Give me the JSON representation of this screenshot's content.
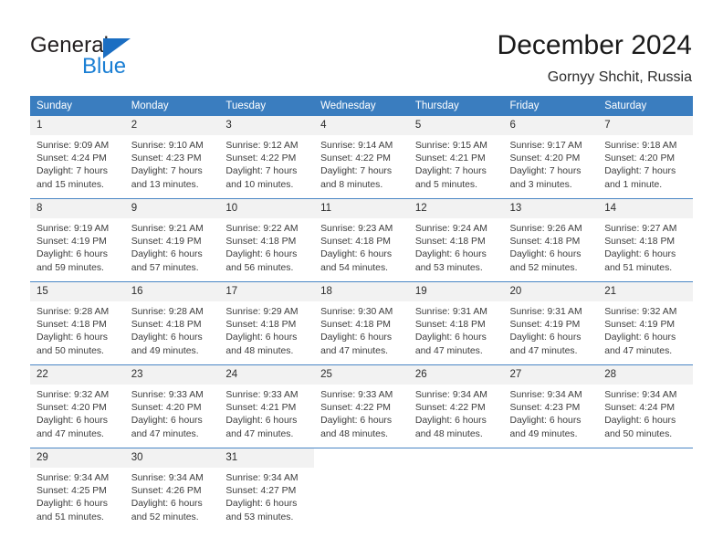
{
  "brand": {
    "name_primary": "General",
    "name_secondary": "Blue",
    "triangle_color": "#1b6ec2",
    "blue_text_color": "#1b7fd4"
  },
  "header": {
    "title": "December 2024",
    "subtitle": "Gornyy Shchit, Russia"
  },
  "theme": {
    "header_bar_color": "#3a7dbf",
    "row_divider_color": "#4a86c5",
    "daynum_band_color": "#f2f2f2",
    "body_text_color": "#3c3c3c"
  },
  "calendar": {
    "weekday_headers": [
      "Sunday",
      "Monday",
      "Tuesday",
      "Wednesday",
      "Thursday",
      "Friday",
      "Saturday"
    ],
    "weeks": [
      [
        {
          "day": "1",
          "lines": [
            "Sunrise: 9:09 AM",
            "Sunset: 4:24 PM",
            "Daylight: 7 hours",
            "and 15 minutes."
          ]
        },
        {
          "day": "2",
          "lines": [
            "Sunrise: 9:10 AM",
            "Sunset: 4:23 PM",
            "Daylight: 7 hours",
            "and 13 minutes."
          ]
        },
        {
          "day": "3",
          "lines": [
            "Sunrise: 9:12 AM",
            "Sunset: 4:22 PM",
            "Daylight: 7 hours",
            "and 10 minutes."
          ]
        },
        {
          "day": "4",
          "lines": [
            "Sunrise: 9:14 AM",
            "Sunset: 4:22 PM",
            "Daylight: 7 hours",
            "and 8 minutes."
          ]
        },
        {
          "day": "5",
          "lines": [
            "Sunrise: 9:15 AM",
            "Sunset: 4:21 PM",
            "Daylight: 7 hours",
            "and 5 minutes."
          ]
        },
        {
          "day": "6",
          "lines": [
            "Sunrise: 9:17 AM",
            "Sunset: 4:20 PM",
            "Daylight: 7 hours",
            "and 3 minutes."
          ]
        },
        {
          "day": "7",
          "lines": [
            "Sunrise: 9:18 AM",
            "Sunset: 4:20 PM",
            "Daylight: 7 hours",
            "and 1 minute."
          ]
        }
      ],
      [
        {
          "day": "8",
          "lines": [
            "Sunrise: 9:19 AM",
            "Sunset: 4:19 PM",
            "Daylight: 6 hours",
            "and 59 minutes."
          ]
        },
        {
          "day": "9",
          "lines": [
            "Sunrise: 9:21 AM",
            "Sunset: 4:19 PM",
            "Daylight: 6 hours",
            "and 57 minutes."
          ]
        },
        {
          "day": "10",
          "lines": [
            "Sunrise: 9:22 AM",
            "Sunset: 4:18 PM",
            "Daylight: 6 hours",
            "and 56 minutes."
          ]
        },
        {
          "day": "11",
          "lines": [
            "Sunrise: 9:23 AM",
            "Sunset: 4:18 PM",
            "Daylight: 6 hours",
            "and 54 minutes."
          ]
        },
        {
          "day": "12",
          "lines": [
            "Sunrise: 9:24 AM",
            "Sunset: 4:18 PM",
            "Daylight: 6 hours",
            "and 53 minutes."
          ]
        },
        {
          "day": "13",
          "lines": [
            "Sunrise: 9:26 AM",
            "Sunset: 4:18 PM",
            "Daylight: 6 hours",
            "and 52 minutes."
          ]
        },
        {
          "day": "14",
          "lines": [
            "Sunrise: 9:27 AM",
            "Sunset: 4:18 PM",
            "Daylight: 6 hours",
            "and 51 minutes."
          ]
        }
      ],
      [
        {
          "day": "15",
          "lines": [
            "Sunrise: 9:28 AM",
            "Sunset: 4:18 PM",
            "Daylight: 6 hours",
            "and 50 minutes."
          ]
        },
        {
          "day": "16",
          "lines": [
            "Sunrise: 9:28 AM",
            "Sunset: 4:18 PM",
            "Daylight: 6 hours",
            "and 49 minutes."
          ]
        },
        {
          "day": "17",
          "lines": [
            "Sunrise: 9:29 AM",
            "Sunset: 4:18 PM",
            "Daylight: 6 hours",
            "and 48 minutes."
          ]
        },
        {
          "day": "18",
          "lines": [
            "Sunrise: 9:30 AM",
            "Sunset: 4:18 PM",
            "Daylight: 6 hours",
            "and 47 minutes."
          ]
        },
        {
          "day": "19",
          "lines": [
            "Sunrise: 9:31 AM",
            "Sunset: 4:18 PM",
            "Daylight: 6 hours",
            "and 47 minutes."
          ]
        },
        {
          "day": "20",
          "lines": [
            "Sunrise: 9:31 AM",
            "Sunset: 4:19 PM",
            "Daylight: 6 hours",
            "and 47 minutes."
          ]
        },
        {
          "day": "21",
          "lines": [
            "Sunrise: 9:32 AM",
            "Sunset: 4:19 PM",
            "Daylight: 6 hours",
            "and 47 minutes."
          ]
        }
      ],
      [
        {
          "day": "22",
          "lines": [
            "Sunrise: 9:32 AM",
            "Sunset: 4:20 PM",
            "Daylight: 6 hours",
            "and 47 minutes."
          ]
        },
        {
          "day": "23",
          "lines": [
            "Sunrise: 9:33 AM",
            "Sunset: 4:20 PM",
            "Daylight: 6 hours",
            "and 47 minutes."
          ]
        },
        {
          "day": "24",
          "lines": [
            "Sunrise: 9:33 AM",
            "Sunset: 4:21 PM",
            "Daylight: 6 hours",
            "and 47 minutes."
          ]
        },
        {
          "day": "25",
          "lines": [
            "Sunrise: 9:33 AM",
            "Sunset: 4:22 PM",
            "Daylight: 6 hours",
            "and 48 minutes."
          ]
        },
        {
          "day": "26",
          "lines": [
            "Sunrise: 9:34 AM",
            "Sunset: 4:22 PM",
            "Daylight: 6 hours",
            "and 48 minutes."
          ]
        },
        {
          "day": "27",
          "lines": [
            "Sunrise: 9:34 AM",
            "Sunset: 4:23 PM",
            "Daylight: 6 hours",
            "and 49 minutes."
          ]
        },
        {
          "day": "28",
          "lines": [
            "Sunrise: 9:34 AM",
            "Sunset: 4:24 PM",
            "Daylight: 6 hours",
            "and 50 minutes."
          ]
        }
      ],
      [
        {
          "day": "29",
          "lines": [
            "Sunrise: 9:34 AM",
            "Sunset: 4:25 PM",
            "Daylight: 6 hours",
            "and 51 minutes."
          ]
        },
        {
          "day": "30",
          "lines": [
            "Sunrise: 9:34 AM",
            "Sunset: 4:26 PM",
            "Daylight: 6 hours",
            "and 52 minutes."
          ]
        },
        {
          "day": "31",
          "lines": [
            "Sunrise: 9:34 AM",
            "Sunset: 4:27 PM",
            "Daylight: 6 hours",
            "and 53 minutes."
          ]
        },
        {
          "day": "",
          "lines": []
        },
        {
          "day": "",
          "lines": []
        },
        {
          "day": "",
          "lines": []
        },
        {
          "day": "",
          "lines": []
        }
      ]
    ]
  }
}
